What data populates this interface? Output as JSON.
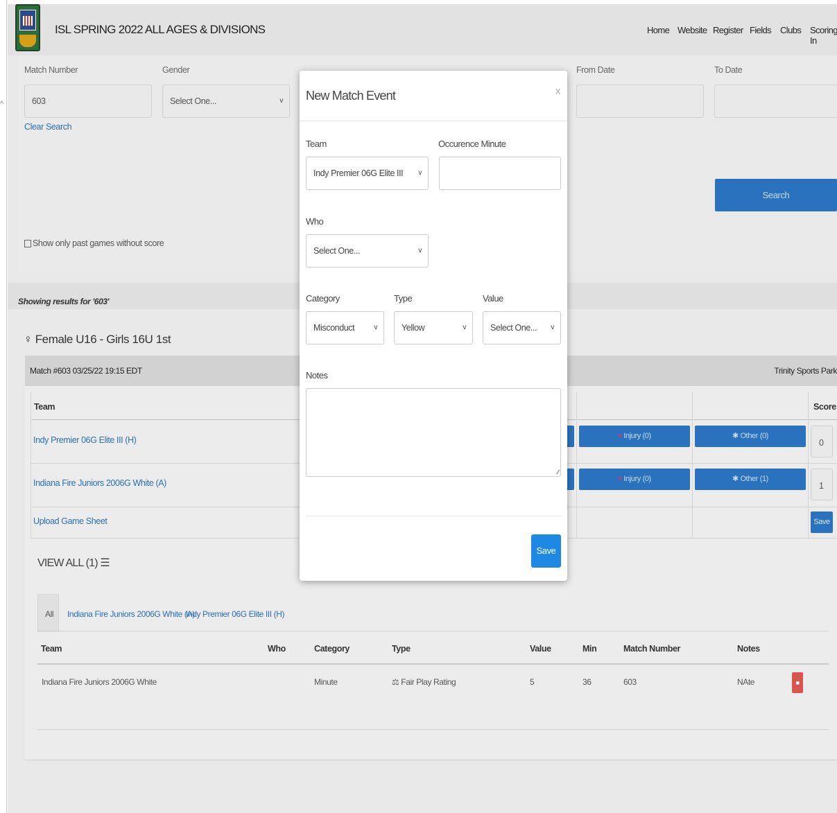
{
  "header": {
    "title": "ISL SPRING 2022 ALL AGES & DIVISIONS",
    "nav": [
      "Home",
      "Website",
      "Register",
      "Fields",
      "Clubs",
      "Scoring In"
    ]
  },
  "search": {
    "match_number_label": "Match Number",
    "match_number_value": "603",
    "gender_label": "Gender",
    "gender_value": "Select One...",
    "from_date_label": "From Date",
    "to_date_label": "To Date",
    "clear_label": "Clear Search",
    "search_button": "Search",
    "past_games_label": "Show only past games without score"
  },
  "results": {
    "showing": "Showing results for '603'",
    "section_title": "Female U16 - Girls 16U 1st",
    "match_line": "Match #603 03/25/22 19:15 EDT",
    "venue": "Trinity Sports Park",
    "col_team": "Team",
    "col_score": "Score",
    "rows": [
      {
        "team": "Indy Premier 06G Elite III (H)",
        "injury": "Injury (0)",
        "other": "Other (0)",
        "score": "0"
      },
      {
        "team": "Indiana Fire Juniors 2006G White (A)",
        "injury": "Injury (0)",
        "other": "Other (1)",
        "score": "1"
      }
    ],
    "upload": "Upload Game Sheet",
    "save_small": "Save",
    "view_all": "VIEW ALL (1)"
  },
  "events": {
    "tabs": [
      "All",
      "Indiana Fire Juniors 2006G White (A)",
      "Indy Premier 06G Elite III (H)"
    ],
    "headers": [
      "Team",
      "Who",
      "Category",
      "Type",
      "Value",
      "Min",
      "Match Number",
      "Notes"
    ],
    "row": {
      "team": "Indiana Fire Juniors 2006G White",
      "who": "",
      "category": "Minute",
      "type": "Fair Play Rating",
      "value": "5",
      "min": "36",
      "match": "603",
      "notes": "NAte"
    }
  },
  "modal": {
    "title": "New Match Event",
    "close": "x",
    "team_label": "Team",
    "team_value": "Indy Premier 06G Elite III",
    "minute_label": "Occurence Minute",
    "who_label": "Who",
    "who_value": "Select One...",
    "category_label": "Category",
    "category_value": "Misconduct",
    "type_label": "Type",
    "type_value": "Yellow",
    "value_label": "Value",
    "value_value": "Select One...",
    "notes_label": "Notes",
    "save": "Save"
  },
  "colors": {
    "primary": "#2a72bd",
    "modal_save": "#1e88e5",
    "link": "#2a6fb8",
    "delete": "#d9534f"
  }
}
